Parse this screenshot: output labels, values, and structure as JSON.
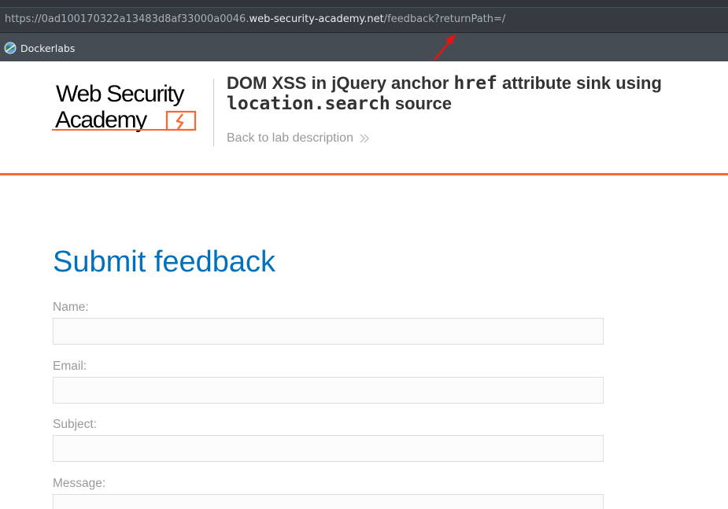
{
  "browser": {
    "url_prefix": "https://0ad100170322a13483d8af33000a0046.",
    "url_host": "web-security-academy.net",
    "url_path": "/feedback?returnPath=/",
    "bookmarks": [
      {
        "label": "Dockerlabs",
        "icon": "dockerlabs-globe-icon"
      }
    ]
  },
  "header": {
    "logo": {
      "line1": "Web Security",
      "line2": "Academy"
    },
    "title_parts": {
      "t1": "DOM XSS in jQuery anchor ",
      "c1": "href",
      "t2": " attribute sink using ",
      "c2": "location.search",
      "t3": " source"
    },
    "back_link": "Back to lab description",
    "accent_color": "#ff6633"
  },
  "form": {
    "title": "Submit feedback",
    "fields": [
      {
        "label": "Name:",
        "value": ""
      },
      {
        "label": "Email:",
        "value": ""
      },
      {
        "label": "Subject:",
        "value": ""
      },
      {
        "label": "Message:",
        "value": ""
      }
    ],
    "title_color": "#0071bc"
  }
}
